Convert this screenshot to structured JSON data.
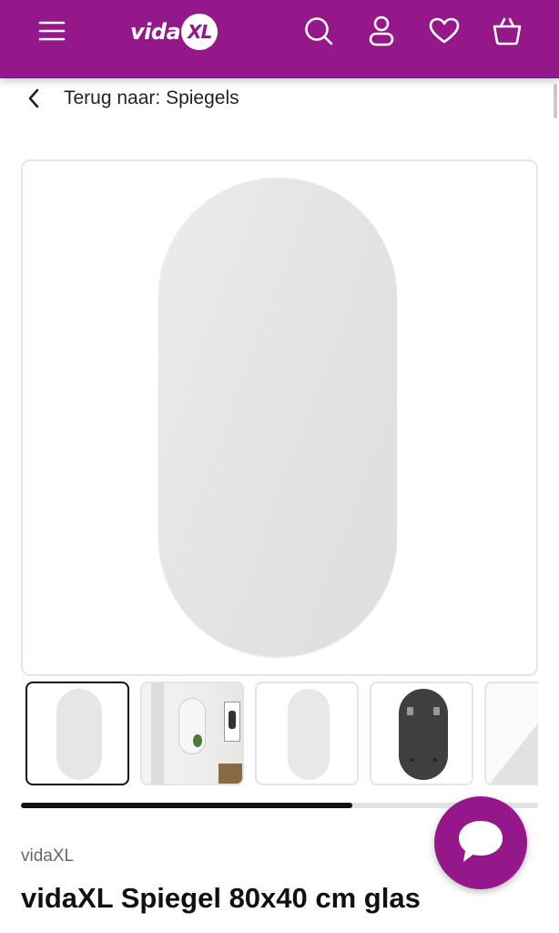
{
  "header": {
    "brand_text": "vida",
    "brand_badge": "XL",
    "icons": {
      "menu": "hamburger-menu-icon",
      "search": "search-icon",
      "account": "user-icon",
      "wishlist": "heart-icon",
      "cart": "basket-icon"
    },
    "colors": {
      "brand": "#94188a"
    }
  },
  "breadcrumb": {
    "back_label": "Terug naar: Spiegels"
  },
  "gallery": {
    "main_image": "oval mirror",
    "thumbnails": [
      {
        "label": "oval mirror",
        "selected": true
      },
      {
        "label": "mirror on wall in room",
        "selected": false
      },
      {
        "label": "oval mirror",
        "selected": false
      },
      {
        "label": "mirror back side",
        "selected": false
      },
      {
        "label": "mirror detail",
        "selected": false
      }
    ],
    "scroll_progress": 0.64
  },
  "product": {
    "brand": "vidaXL",
    "title": "vidaXL Spiegel 80x40 cm glas"
  },
  "chat": {
    "icon": "chat-bubble-icon"
  }
}
